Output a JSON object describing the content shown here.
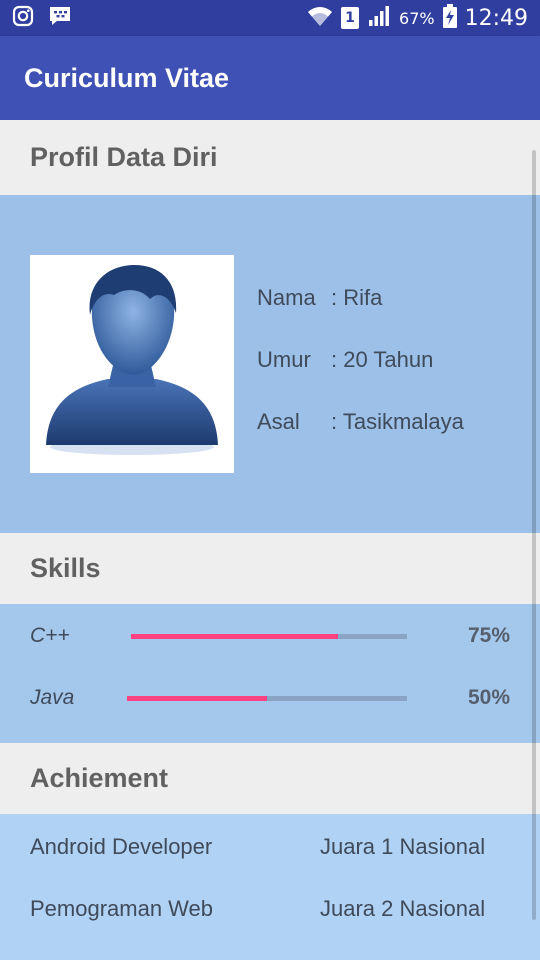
{
  "status_bar": {
    "left_icons": [
      "instagram-icon",
      "bbm-icon"
    ],
    "sim_slot": "1",
    "battery_percent": "67%",
    "time": "12:49"
  },
  "app_bar": {
    "title": "Curiculum Vitae"
  },
  "profile": {
    "header": "Profil Data Diri",
    "fields": [
      {
        "label": "Nama",
        "value": ": Rifa"
      },
      {
        "label": "Umur",
        "value": ": 20 Tahun"
      },
      {
        "label": "Asal",
        "value": ": Tasikmalaya"
      }
    ]
  },
  "skills": {
    "header": "Skills",
    "items": [
      {
        "name": "C++",
        "percent_label": "75%",
        "level": 0.75
      },
      {
        "name": "Java",
        "percent_label": "50%",
        "level": 0.5
      }
    ]
  },
  "achievement": {
    "header": "Achiement",
    "items": [
      {
        "title": "Android Developer",
        "rank": "Juara 1 Nasional"
      },
      {
        "title": "Pemograman Web",
        "rank": "Juara 2 Nasional"
      }
    ]
  },
  "colors": {
    "primary": "#3f51b5",
    "primary_dark": "#303f9f",
    "accent": "#ff4081"
  }
}
